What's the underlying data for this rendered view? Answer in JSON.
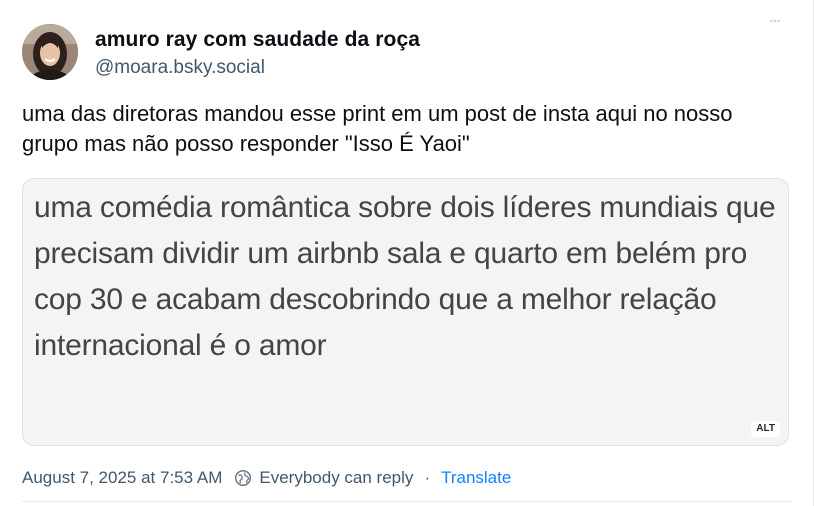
{
  "post": {
    "author": {
      "display_name": "amuro ray com saudade da roça",
      "handle": "@moara.bsky.social"
    },
    "text": "uma das diretoras mandou esse print em um post de insta aqui no nosso grupo mas não posso responder \"Isso É Yaoi\"",
    "embed_image": {
      "text": "uma comédia romântica sobre dois líderes mundiais que precisam dividir um airbnb sala e quarto em belém pro cop 30 e acabam descobrindo que a melhor relação internacional é o amor",
      "alt_badge": "ALT"
    },
    "footer": {
      "timestamp": "August 7, 2025 at 7:53 AM",
      "reply_setting": "Everybody can reply",
      "separator": "·",
      "translate_label": "Translate"
    }
  },
  "colors": {
    "accent": "#1083fe",
    "muted_text": "#42576c",
    "primary_text": "#0b0f14",
    "embed_background": "#f4f4f4"
  },
  "icons": {
    "more": "more-dots-icon",
    "reply_setting": "earth-reply-icon"
  }
}
